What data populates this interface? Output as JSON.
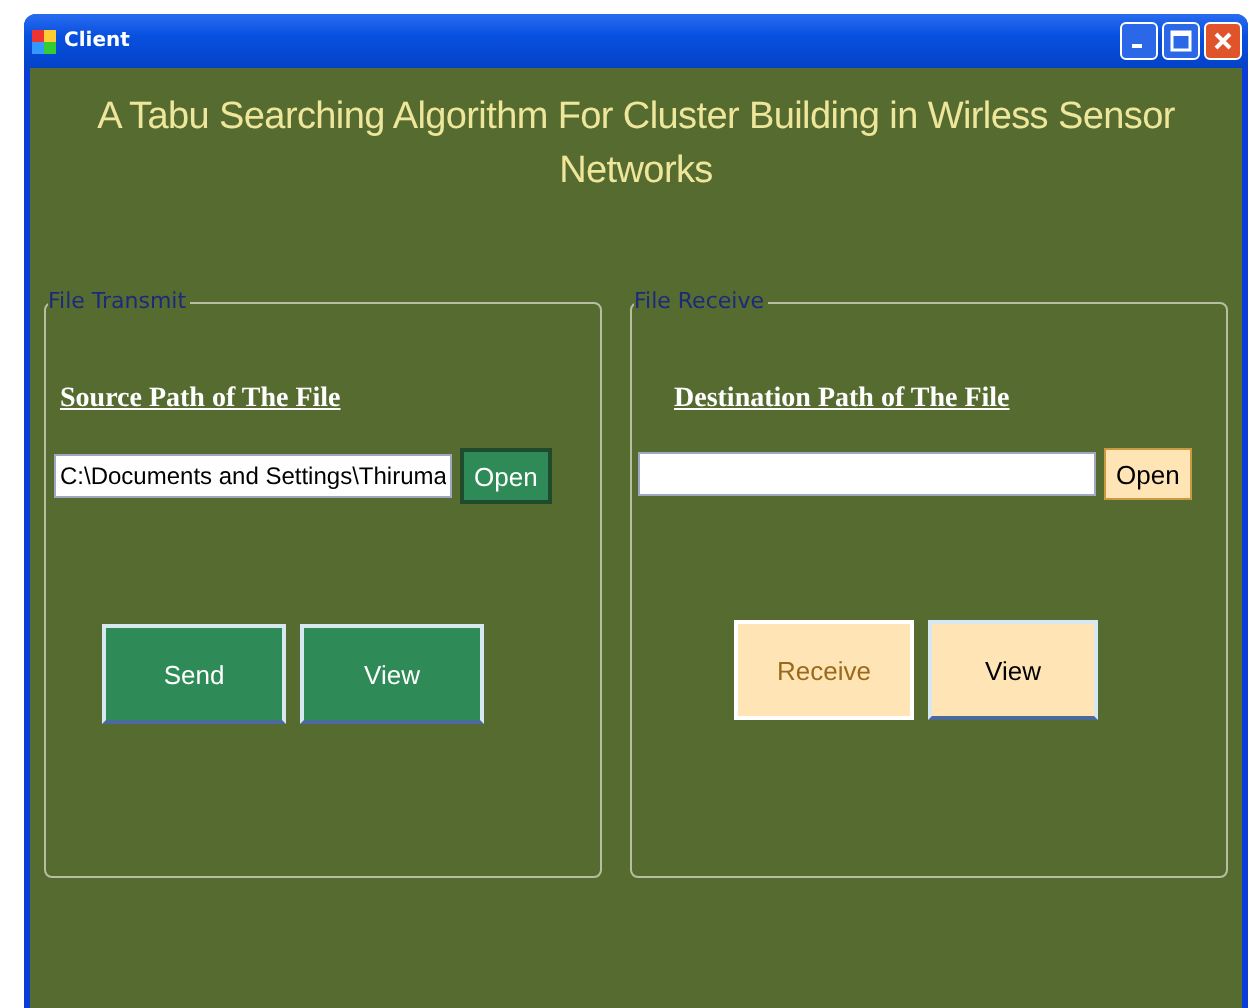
{
  "window": {
    "title": "Client"
  },
  "heading": "A Tabu Searching Algorithm For Cluster Building in Wirless Sensor Networks",
  "panels": [
    {
      "legend": "File Transmit",
      "label": "Source Path of The File",
      "path": {
        "value": "C:\\Documents and Settings\\Thiruma"
      },
      "open_button": "Open",
      "buttons": [
        "Send",
        "View"
      ]
    },
    {
      "legend": "File Receive",
      "label": "Destination Path of The File",
      "open_button": "Open",
      "buttons": [
        "Receive",
        "View"
      ]
    }
  ]
}
